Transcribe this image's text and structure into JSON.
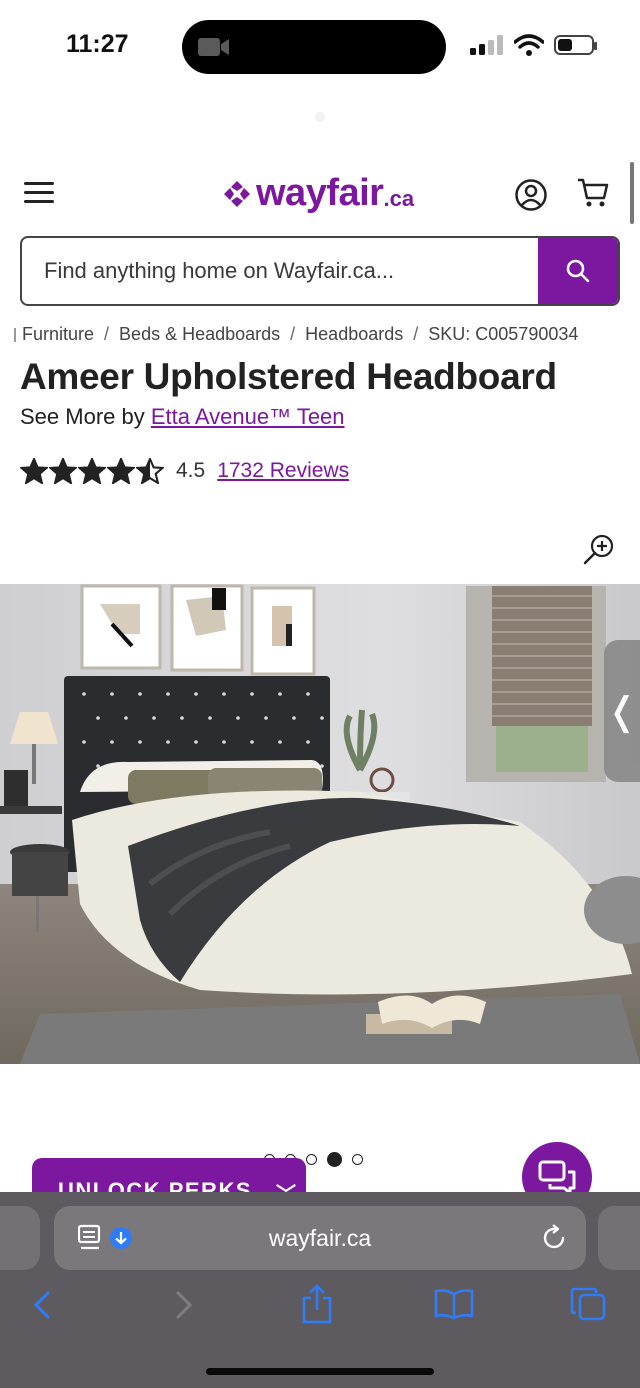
{
  "status_bar": {
    "time": "11:27",
    "battery_level": 0.45,
    "signal_bars_active": 2,
    "signal_bars_total": 4
  },
  "header": {
    "logo_text": "wayfair",
    "logo_tld": ".ca",
    "brand_color": "#7b189f",
    "icons": [
      "menu-icon",
      "account-icon",
      "cart-icon"
    ]
  },
  "search": {
    "placeholder": "Find anything home on Wayfair.ca...",
    "button_icon": "search-icon"
  },
  "breadcrumb": {
    "items": [
      "Furniture",
      "Beds & Headboards",
      "Headboards"
    ],
    "sku": "SKU: C005790034"
  },
  "product": {
    "title": "Ameer Upholstered Headboard",
    "see_more_prefix": "See More by",
    "brand": "Etta Avenue™ Teen",
    "rating": 4.5,
    "rating_text": "4.5",
    "reviews": "1732 Reviews"
  },
  "carousel": {
    "total": 5,
    "active_index": 3
  },
  "promo": {
    "unlock_label": "UNLOCK PERKS"
  },
  "browser": {
    "url": "wayfair.ca",
    "accent": "#2f7cf6"
  }
}
